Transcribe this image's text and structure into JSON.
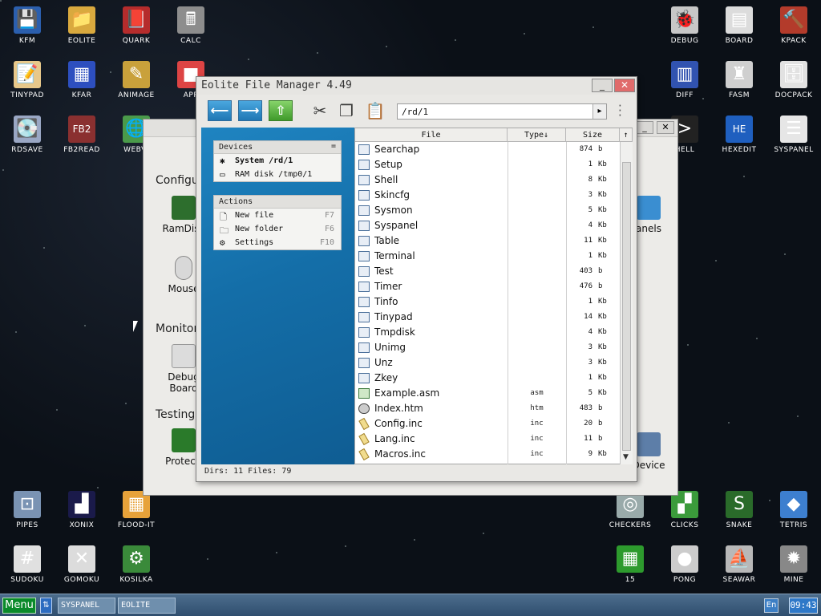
{
  "desktop_icons": [
    {
      "id": "kfm",
      "label": "KFM",
      "icon": "floppy-icon",
      "color": "#2b5fae",
      "glyph": "💾"
    },
    {
      "id": "eolite",
      "label": "EOLITE",
      "icon": "folder-icon",
      "color": "#d9a93e",
      "glyph": "📁"
    },
    {
      "id": "quark",
      "label": "QUARK",
      "icon": "notebook-icon",
      "color": "#b52c2c",
      "glyph": "📕"
    },
    {
      "id": "calc",
      "label": "CALC",
      "icon": "calculator-icon",
      "color": "#8d8d8d",
      "glyph": "🖩"
    },
    {
      "id": "debug",
      "label": "DEBUG",
      "icon": "bug-icon",
      "color": "#c7c7c7",
      "glyph": "🐞"
    },
    {
      "id": "board",
      "label": "BOARD",
      "icon": "board-icon",
      "color": "#dcdcdc",
      "glyph": "▤"
    },
    {
      "id": "kpack",
      "label": "KPACK",
      "icon": "hammer-icon",
      "color": "#b33b2b",
      "glyph": "🔨"
    },
    {
      "id": "tinypad",
      "label": "TINYPAD",
      "icon": "pencil-icon",
      "color": "#e8c88a",
      "glyph": "📝"
    },
    {
      "id": "kfar",
      "label": "KFAR",
      "icon": "kfar-icon",
      "color": "#2d4fbf",
      "glyph": "▦"
    },
    {
      "id": "animage",
      "label": "ANIMAGE",
      "icon": "brush-icon",
      "color": "#c9a13b",
      "glyph": "✎"
    },
    {
      "id": "app",
      "label": "APP",
      "icon": "cube-icon",
      "color": "#d44",
      "glyph": "■"
    },
    {
      "id": "diff",
      "label": "DIFF",
      "icon": "diff-icon",
      "color": "#3153b0",
      "glyph": "▥"
    },
    {
      "id": "fasm",
      "label": "FASM",
      "icon": "elephant-icon",
      "color": "#cfcfcf",
      "glyph": "♜"
    },
    {
      "id": "docpack",
      "label": "DOCPACK",
      "icon": "cabinet-icon",
      "color": "#e2e2e2",
      "glyph": "🗄"
    },
    {
      "id": "rdsave",
      "label": "RDSAVE",
      "icon": "save-disk-icon",
      "color": "#9aa7c4",
      "glyph": "💽"
    },
    {
      "id": "fb2read",
      "label": "FB2READ",
      "icon": "book-icon",
      "color": "#8a3030",
      "glyph": "FB2"
    },
    {
      "id": "webview",
      "label": "WEBVI",
      "icon": "globe-icon",
      "color": "#4a9a4a",
      "glyph": "🌐"
    },
    {
      "id": "shell",
      "label": "HELL",
      "icon": "terminal-icon",
      "color": "#222",
      "glyph": ">"
    },
    {
      "id": "hexedit",
      "label": "HEXEDIT",
      "icon": "hex-icon",
      "color": "#1f5fbf",
      "glyph": "HE"
    },
    {
      "id": "syspanel",
      "label": "SYSPANEL",
      "icon": "sliders-icon",
      "color": "#e6e6e6",
      "glyph": "☰"
    },
    {
      "id": "pipes",
      "label": "PIPES",
      "icon": "pipes-icon",
      "color": "#7a93b3",
      "glyph": "⊡"
    },
    {
      "id": "xonix",
      "label": "XONIX",
      "icon": "xonix-icon",
      "color": "#1a1a4a",
      "glyph": "▟"
    },
    {
      "id": "floodit",
      "label": "FLOOD-IT",
      "icon": "grid-icon",
      "color": "#e7a23a",
      "glyph": "▦"
    },
    {
      "id": "checkers",
      "label": "CHECKERS",
      "icon": "checkers-icon",
      "color": "#9aa",
      "glyph": "◎"
    },
    {
      "id": "clicks",
      "label": "CLICKS",
      "icon": "blocks-icon",
      "color": "#3b9b3b",
      "glyph": "▞"
    },
    {
      "id": "snake",
      "label": "SNAKE",
      "icon": "snake-icon",
      "color": "#2a6b2a",
      "glyph": "S"
    },
    {
      "id": "tetris",
      "label": "TETRIS",
      "icon": "tetris-icon",
      "color": "#3d7fcf",
      "glyph": "◆"
    },
    {
      "id": "sudoku",
      "label": "SUDOKU",
      "icon": "sudoku-icon",
      "color": "#e0e0e0",
      "glyph": "#"
    },
    {
      "id": "gomoku",
      "label": "GOMOKU",
      "icon": "gomoku-icon",
      "color": "#dcdcdc",
      "glyph": "✕"
    },
    {
      "id": "kosilka",
      "label": "KOSILKA",
      "icon": "lawnmower-icon",
      "color": "#3a8a3a",
      "glyph": "⚙"
    },
    {
      "id": "fifteen",
      "label": "15",
      "icon": "fifteen-icon",
      "color": "#2d9a2d",
      "glyph": "▦"
    },
    {
      "id": "pong",
      "label": "PONG",
      "icon": "pong-icon",
      "color": "#ccc",
      "glyph": "●"
    },
    {
      "id": "seawar",
      "label": "SEAWAR",
      "icon": "ship-icon",
      "color": "#b8b8b8",
      "glyph": "⛵"
    },
    {
      "id": "mine",
      "label": "MINE",
      "icon": "mine-icon",
      "color": "#888",
      "glyph": "✹"
    }
  ],
  "bg_window": {
    "sections": [
      "Configur",
      "Monitori",
      "Testing"
    ],
    "items": [
      "RamDisk",
      "Mouse",
      "Debug",
      "Board",
      "Protecti",
      "anels",
      "Device"
    ]
  },
  "eolite": {
    "title": "Eolite File Manager 4.49",
    "path": "/rd/1",
    "devices_header": "Devices",
    "devices": [
      {
        "label": "System /rd/1",
        "icon": "system-disk-icon"
      },
      {
        "label": "RAM disk /tmp0/1",
        "icon": "ram-disk-icon"
      }
    ],
    "actions_header": "Actions",
    "actions": [
      {
        "label": "New file",
        "key": "F7",
        "icon": "new-file-icon"
      },
      {
        "label": "New folder",
        "key": "F6",
        "icon": "new-folder-icon"
      },
      {
        "label": "Settings",
        "key": "F10",
        "icon": "settings-icon"
      }
    ],
    "columns": {
      "file": "File",
      "type": "Type↓",
      "size": "Size",
      "up": "↑"
    },
    "files": [
      {
        "name": "Searchap",
        "type": "",
        "size": "874",
        "unit": "b",
        "kind": "app"
      },
      {
        "name": "Setup",
        "type": "",
        "size": "1",
        "unit": "Kb",
        "kind": "app"
      },
      {
        "name": "Shell",
        "type": "",
        "size": "8",
        "unit": "Kb",
        "kind": "app"
      },
      {
        "name": "Skincfg",
        "type": "",
        "size": "3",
        "unit": "Kb",
        "kind": "app"
      },
      {
        "name": "Sysmon",
        "type": "",
        "size": "5",
        "unit": "Kb",
        "kind": "app"
      },
      {
        "name": "Syspanel",
        "type": "",
        "size": "4",
        "unit": "Kb",
        "kind": "app"
      },
      {
        "name": "Table",
        "type": "",
        "size": "11",
        "unit": "Kb",
        "kind": "app"
      },
      {
        "name": "Terminal",
        "type": "",
        "size": "1",
        "unit": "Kb",
        "kind": "app"
      },
      {
        "name": "Test",
        "type": "",
        "size": "403",
        "unit": "b",
        "kind": "app"
      },
      {
        "name": "Timer",
        "type": "",
        "size": "476",
        "unit": "b",
        "kind": "app"
      },
      {
        "name": "Tinfo",
        "type": "",
        "size": "1",
        "unit": "Kb",
        "kind": "app"
      },
      {
        "name": "Tinypad",
        "type": "",
        "size": "14",
        "unit": "Kb",
        "kind": "app"
      },
      {
        "name": "Tmpdisk",
        "type": "",
        "size": "4",
        "unit": "Kb",
        "kind": "app"
      },
      {
        "name": "Unimg",
        "type": "",
        "size": "3",
        "unit": "Kb",
        "kind": "app"
      },
      {
        "name": "Unz",
        "type": "",
        "size": "3",
        "unit": "Kb",
        "kind": "app"
      },
      {
        "name": "Zkey",
        "type": "",
        "size": "1",
        "unit": "Kb",
        "kind": "app"
      },
      {
        "name": "Example.asm",
        "type": "asm",
        "size": "5",
        "unit": "Kb",
        "kind": "asm"
      },
      {
        "name": "Index.htm",
        "type": "htm",
        "size": "483",
        "unit": "b",
        "kind": "web"
      },
      {
        "name": "Config.inc",
        "type": "inc",
        "size": "20",
        "unit": "b",
        "kind": "inc"
      },
      {
        "name": "Lang.inc",
        "type": "inc",
        "size": "11",
        "unit": "b",
        "kind": "inc"
      },
      {
        "name": "Macros.inc",
        "type": "inc",
        "size": "9",
        "unit": "Kb",
        "kind": "inc"
      }
    ],
    "status": "Dirs: 11   Files: 79"
  },
  "taskbar": {
    "menu": "Menu",
    "tasks": [
      "SYSPANEL",
      "EOLITE"
    ],
    "lang": "En",
    "clock": "09:43"
  }
}
